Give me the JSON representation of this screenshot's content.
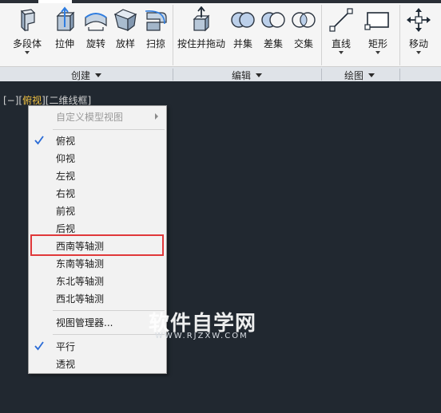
{
  "ribbon": {
    "buttons": [
      {
        "label": "多段体",
        "icon": "polysolid-icon",
        "has_dropdown": true
      },
      {
        "label": "拉伸",
        "icon": "extrude-icon",
        "has_dropdown": false
      },
      {
        "label": "旋转",
        "icon": "revolve-icon",
        "has_dropdown": false
      },
      {
        "label": "放样",
        "icon": "loft-icon",
        "has_dropdown": false
      },
      {
        "label": "扫掠",
        "icon": "sweep-icon",
        "has_dropdown": false
      },
      {
        "label": "按住并拖动",
        "icon": "presspull-icon",
        "has_dropdown": false
      },
      {
        "label": "并集",
        "icon": "union-icon",
        "has_dropdown": false
      },
      {
        "label": "差集",
        "icon": "subtract-icon",
        "has_dropdown": false
      },
      {
        "label": "交集",
        "icon": "intersect-icon",
        "has_dropdown": false
      },
      {
        "label": "直线",
        "icon": "line-icon",
        "has_dropdown": true
      },
      {
        "label": "矩形",
        "icon": "rectangle-icon",
        "has_dropdown": true
      },
      {
        "label": "移动",
        "icon": "move-icon",
        "has_dropdown": true
      }
    ],
    "panels": [
      "创建",
      "编辑",
      "绘图"
    ]
  },
  "viewport": {
    "label_prefix": "[−][",
    "label_view": "俯视",
    "label_suffix": "][二维线框]"
  },
  "menu": {
    "items": [
      {
        "label": "自定义模型视图",
        "checked": false,
        "disabled": true,
        "submenu": true
      },
      {
        "label": "俯视",
        "checked": true,
        "disabled": false,
        "submenu": false
      },
      {
        "label": "仰视",
        "checked": false,
        "disabled": false,
        "submenu": false
      },
      {
        "label": "左视",
        "checked": false,
        "disabled": false,
        "submenu": false
      },
      {
        "label": "右视",
        "checked": false,
        "disabled": false,
        "submenu": false
      },
      {
        "label": "前视",
        "checked": false,
        "disabled": false,
        "submenu": false
      },
      {
        "label": "后视",
        "checked": false,
        "disabled": false,
        "submenu": false
      },
      {
        "label": "西南等轴测",
        "checked": false,
        "disabled": false,
        "submenu": false,
        "highlighted": true
      },
      {
        "label": "东南等轴测",
        "checked": false,
        "disabled": false,
        "submenu": false
      },
      {
        "label": "东北等轴测",
        "checked": false,
        "disabled": false,
        "submenu": false
      },
      {
        "label": "西北等轴测",
        "checked": false,
        "disabled": false,
        "submenu": false
      },
      {
        "label": "视图管理器...",
        "checked": false,
        "disabled": false,
        "submenu": false
      },
      {
        "label": "平行",
        "checked": true,
        "disabled": false,
        "submenu": false
      },
      {
        "label": "透视",
        "checked": false,
        "disabled": false,
        "submenu": false
      }
    ]
  },
  "watermark": {
    "title": "软件自学网",
    "url": "WWW.RJZXW.COM"
  },
  "colors": {
    "accent": "#2a6bd6",
    "highlight_box": "#e0383a",
    "viewport_bg": "#212830",
    "view_label_highlight": "#f0c040"
  }
}
